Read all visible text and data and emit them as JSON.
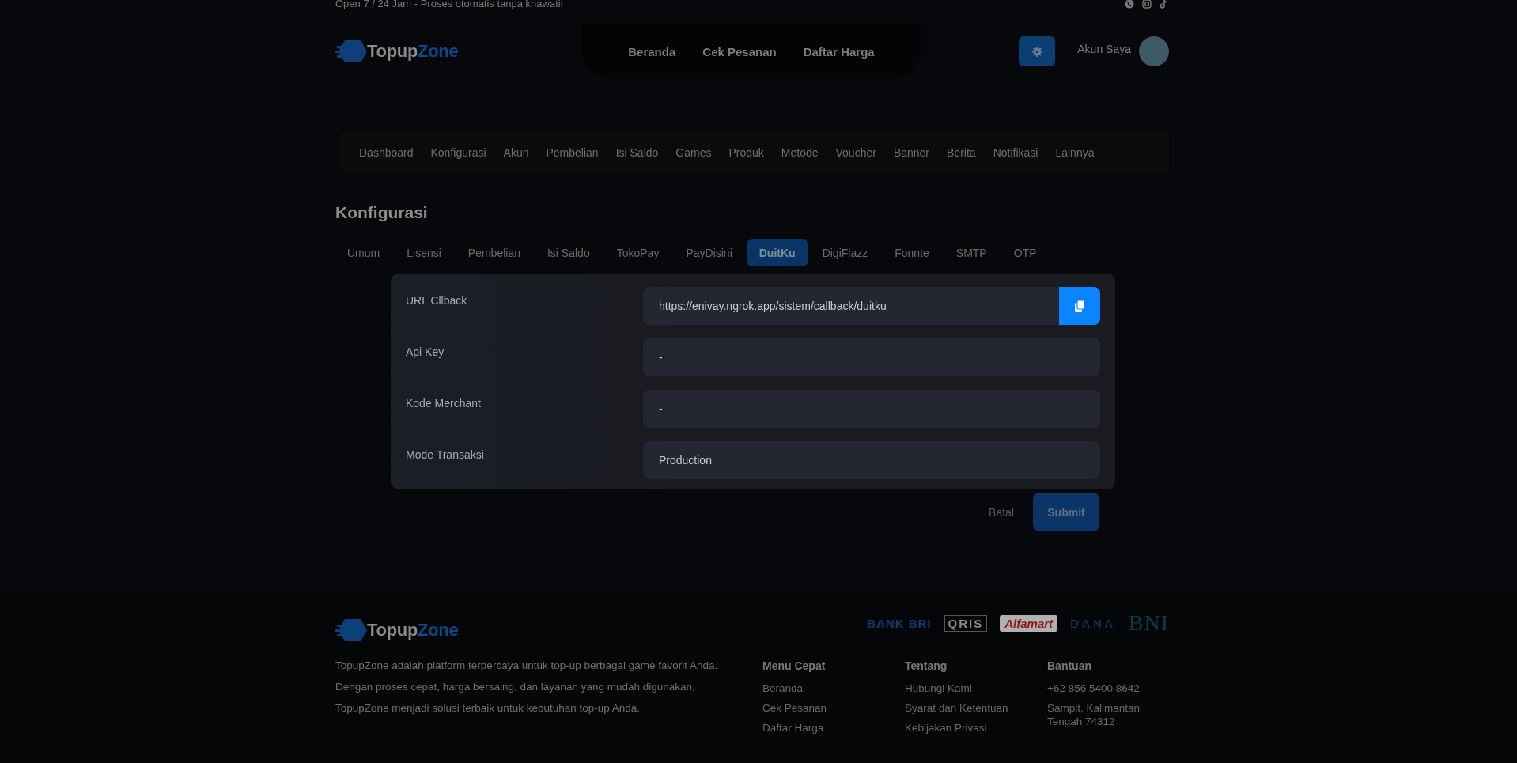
{
  "top_bar": {
    "notice": "Open 7 / 24 Jam - Proses otomatis tanpa khawatir"
  },
  "header": {
    "logo": "TopupZone",
    "nav": [
      {
        "label": "Beranda",
        "selected": false
      },
      {
        "label": "Cek Pesanan",
        "selected": false
      },
      {
        "label": "Daftar Harga",
        "selected": false
      }
    ],
    "account": "Akun Saya"
  },
  "admin_menu": [
    {
      "label": "Dashboard",
      "selected": false
    },
    {
      "label": "Konfigurasi",
      "selected": false
    },
    {
      "label": "Akun",
      "selected": false
    },
    {
      "label": "Pembelian",
      "selected": false
    },
    {
      "label": "Isi Saldo",
      "selected": false
    },
    {
      "label": "Games",
      "selected": false
    },
    {
      "label": "Produk",
      "selected": false
    },
    {
      "label": "Metode",
      "selected": false
    },
    {
      "label": "Voucher",
      "selected": false
    },
    {
      "label": "Banner",
      "selected": false
    },
    {
      "label": "Berita",
      "selected": false
    },
    {
      "label": "Notifikasi",
      "selected": false
    },
    {
      "label": "Lainnya",
      "selected": false
    }
  ],
  "page_title": "Konfigurasi",
  "tabs": [
    {
      "label": "Umum",
      "selected": false
    },
    {
      "label": "Lisensi",
      "selected": false
    },
    {
      "label": "Pembelian",
      "selected": false
    },
    {
      "label": "Isi Saldo",
      "selected": false
    },
    {
      "label": "TokoPay",
      "selected": false
    },
    {
      "label": "PayDisini",
      "selected": false
    },
    {
      "label": "DuitKu",
      "selected": true
    },
    {
      "label": "DigiFlazz",
      "selected": false
    },
    {
      "label": "Fonnte",
      "selected": false
    },
    {
      "label": "SMTP",
      "selected": false
    },
    {
      "label": "OTP",
      "selected": false
    }
  ],
  "form": {
    "fields": [
      {
        "label": "URL Cllback",
        "value": "https://enivay.ngrok.app/sistem/callback/duitku",
        "kind": "copy"
      },
      {
        "label": "Api Key",
        "value": "-",
        "kind": "text"
      },
      {
        "label": "Kode Merchant",
        "value": "-",
        "kind": "text"
      },
      {
        "label": "Mode Transaksi",
        "value": "Production",
        "kind": "text"
      }
    ],
    "buttons": [
      "Batal",
      "Submit"
    ]
  },
  "footer": {
    "logo": "TopupZone",
    "payment_logos": [
      "BANK BRI",
      "QRIS",
      "Alfamart",
      "DANA",
      "BNI"
    ],
    "description": "TopupZone adalah platform terpercaya untuk top-up berbagai game favorit Anda. Dengan proses cepat, harga bersaing, dan layanan yang mudah digunakan, TopupZone menjadi solusi terbaik untuk kebutuhan top-up Anda.",
    "columns": [
      {
        "title": "Menu Cepat",
        "links": [
          "Beranda",
          "Cek Pesanan",
          "Daftar Harga"
        ]
      },
      {
        "title": "Tentang",
        "links": [
          "Hubungi Kami",
          "Syarat dan Ketentuan",
          "Kebijakan Privasi"
        ]
      },
      {
        "title": "Bantuan",
        "links": [
          "+62 856 5400 8642",
          "Sampit, Kalimantan Tengah 74312"
        ]
      }
    ]
  }
}
